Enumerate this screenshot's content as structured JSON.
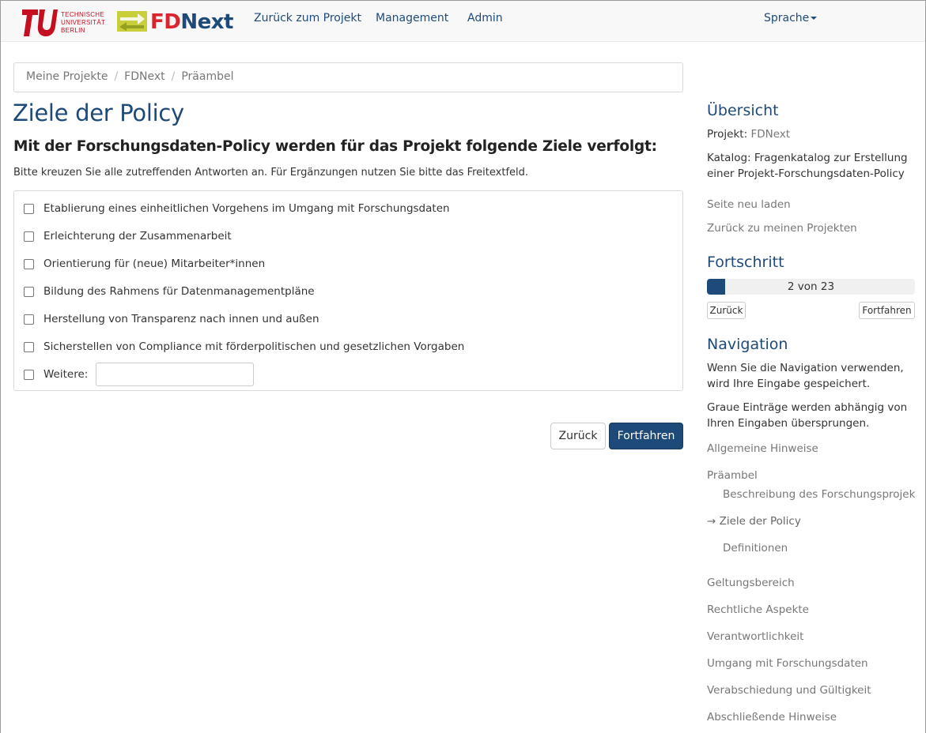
{
  "branding": {
    "university_lines": [
      "TECHNISCHE",
      "UNIVERSITÄT",
      "BERLIN"
    ],
    "app_name_part1": "FD",
    "app_name_part2": "Next",
    "brand_red": "#c50e1f",
    "brand_blue": "#1e4a7a"
  },
  "navbar": {
    "links": [
      "Zurück zum Projekt",
      "Management",
      "Admin"
    ],
    "language": "Sprache"
  },
  "breadcrumb": [
    "Meine Projekte",
    "FDNext",
    "Präambel"
  ],
  "main": {
    "title": "Ziele der Policy",
    "question": "Mit der Forschungsdaten-Policy werden für das Projekt folgende Ziele verfolgt:",
    "help": "Bitte kreuzen Sie alle zutreffenden Antworten an. Für Ergänzungen nutzen Sie bitte das Freitextfeld.",
    "options": [
      "Etablierung eines einheitlichen Vorgehens im Umgang mit Forschungsdaten",
      "Erleichterung der Zusammenarbeit",
      "Orientierung für (neue) Mitarbeiter*innen",
      "Bildung des Rahmens für Datenmanagementpläne",
      "Herstellung von Transparenz nach innen und außen",
      "Sicherstellen von Compliance mit förderpolitischen und gesetzlichen Vorgaben"
    ],
    "other_label": "Weitere:",
    "other_value": "",
    "back_label": "Zurück",
    "next_label": "Fortfahren"
  },
  "sidebar": {
    "overview_heading": "Übersicht",
    "project_label": "Projekt:",
    "project_value": "FDNext",
    "catalog_label": "Katalog:",
    "catalog_value": "Fragenkatalog zur Erstellung einer Projekt-Forschungsdaten-Policy",
    "reload": "Seite neu laden",
    "back_to_projects": "Zurück zu meinen Projekten",
    "progress_heading": "Fortschritt",
    "progress_current": 2,
    "progress_total": 23,
    "progress_text": "2 von 23",
    "progress_back": "Zurück",
    "progress_next": "Fortfahren",
    "navigation_heading": "Navigation",
    "nav_info1": "Wenn Sie die Navigation verwenden, wird Ihre Eingabe gespeichert.",
    "nav_info2": "Graue Einträge werden abhängig von Ihren Eingaben übersprungen.",
    "nav_items": [
      "Allgemeine Hinweise",
      "Präambel",
      "Beschreibung des Forschungsprojek…",
      "→ Ziele der Policy",
      "Definitionen",
      "Geltungsbereich",
      "Rechtliche Aspekte",
      "Verantwortlichkeit",
      "Umgang mit Forschungsdaten",
      "Verabschiedung und Gültigkeit",
      "Abschließende Hinweise"
    ]
  }
}
